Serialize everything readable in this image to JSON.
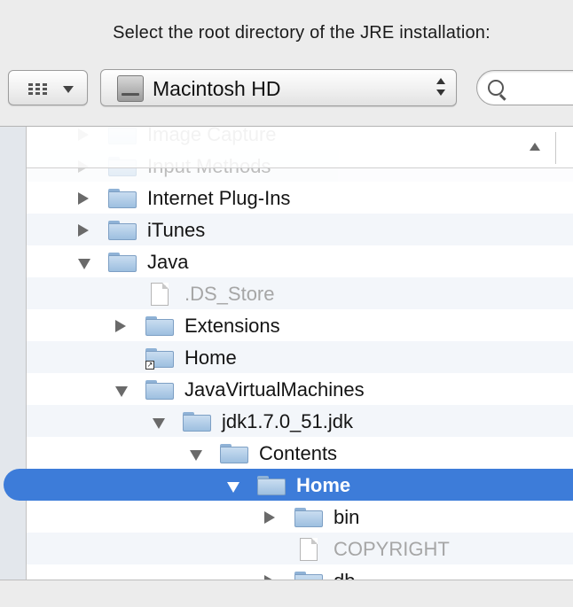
{
  "dialog": {
    "title": "Select the root directory of the JRE installation:"
  },
  "toolbar": {
    "view_menu_icon": "icon-grid-view",
    "path_popup": {
      "label": "Macintosh HD",
      "icon": "hard-drive-icon"
    },
    "search": {
      "value": "",
      "placeholder": ""
    }
  },
  "colors": {
    "selection": "#3d7cd9",
    "folder": "#9dbfe0",
    "dim_text": "#a6a6a6"
  },
  "rows": [
    {
      "label": "Image Capture",
      "kind": "folder",
      "disclosure": "right",
      "level": 0,
      "faded": true
    },
    {
      "label": "Input Methods",
      "kind": "folder",
      "disclosure": "right",
      "level": 0,
      "faded": true
    },
    {
      "label": "Internet Plug-Ins",
      "kind": "folder",
      "disclosure": "right",
      "level": 0
    },
    {
      "label": "iTunes",
      "kind": "folder",
      "disclosure": "right",
      "level": 0
    },
    {
      "label": "Java",
      "kind": "folder",
      "disclosure": "down",
      "level": 0
    },
    {
      "label": ".DS_Store",
      "kind": "file",
      "disclosure": "none",
      "level": 1,
      "dim": true
    },
    {
      "label": "Extensions",
      "kind": "folder",
      "disclosure": "right",
      "level": 1
    },
    {
      "label": "Home",
      "kind": "alias",
      "disclosure": "none",
      "level": 1
    },
    {
      "label": "JavaVirtualMachines",
      "kind": "folder",
      "disclosure": "down",
      "level": 1
    },
    {
      "label": "jdk1.7.0_51.jdk",
      "kind": "folder",
      "disclosure": "down",
      "level": 2
    },
    {
      "label": "Contents",
      "kind": "folder",
      "disclosure": "down",
      "level": 3
    },
    {
      "label": "Home",
      "kind": "folder",
      "disclosure": "down",
      "level": 4,
      "selected": true
    },
    {
      "label": "bin",
      "kind": "folder",
      "disclosure": "right",
      "level": 5
    },
    {
      "label": "COPYRIGHT",
      "kind": "file",
      "disclosure": "none",
      "level": 5,
      "dim": true
    },
    {
      "label": "db",
      "kind": "folder",
      "disclosure": "right",
      "level": 5
    }
  ]
}
